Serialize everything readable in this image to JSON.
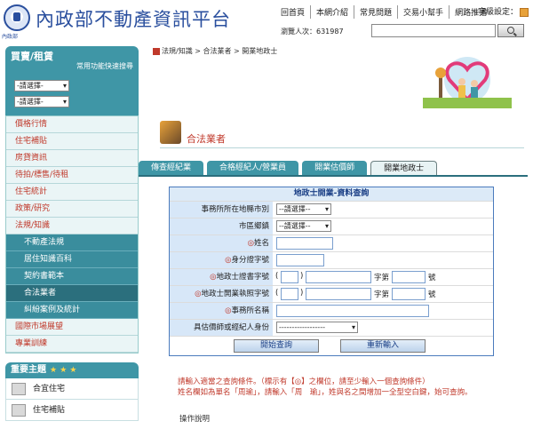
{
  "header": {
    "site_title": "內政部不動產資訊平台",
    "logo_caption": "內政部",
    "nav": [
      "回首頁",
      "本網介紹",
      "常見問題",
      "交易小幫手",
      "網路推播"
    ],
    "fontsize_label": "字級設定：",
    "visitors_label": "瀏覽人次：",
    "visitors_count": "631987",
    "search_placeholder": ""
  },
  "sidebar": {
    "buy_title": "買賣/租賃",
    "buy_subtitle": "常用功能快速搜尋",
    "select1": "-請選擇-",
    "select2": "-請選擇-",
    "menu": [
      {
        "label": "價格行情",
        "type": "main"
      },
      {
        "label": "住宅補貼",
        "type": "main"
      },
      {
        "label": "房貸資訊",
        "type": "main"
      },
      {
        "label": "待拍/標售/待租",
        "type": "main"
      },
      {
        "label": "住宅統計",
        "type": "main"
      },
      {
        "label": "政策/研究",
        "type": "main"
      },
      {
        "label": "法規/知識",
        "type": "main"
      },
      {
        "label": "不動產法規",
        "type": "sub"
      },
      {
        "label": "居住知識百科",
        "type": "sub"
      },
      {
        "label": "契約書範本",
        "type": "sub"
      },
      {
        "label": "合法業者",
        "type": "sub-active"
      },
      {
        "label": "糾紛案例及統計",
        "type": "sub"
      },
      {
        "label": "國際市場展望",
        "type": "main"
      },
      {
        "label": "專業訓練",
        "type": "main"
      }
    ],
    "important_title": "重要主題",
    "important_stars": "★ ★ ★",
    "important_items": [
      "合宜住宅",
      "住宅補貼"
    ]
  },
  "main": {
    "breadcrumb": "法規/知識 > 合法業者 > 開業地政士",
    "section_title": "合法業者",
    "tabs": [
      {
        "label": "傳查經紀業",
        "active": false
      },
      {
        "label": "合格經紀人/營業員",
        "active": false
      },
      {
        "label": "開業估價師",
        "active": false
      },
      {
        "label": "開業地政士",
        "active": true
      }
    ],
    "form": {
      "title": "地政士開業-資料查詢",
      "city_label": "事務所所在地縣市別",
      "city_value": "--請選擇--",
      "district_label": "市區鄉鎮",
      "district_value": "--請選擇--",
      "name_label": "姓名",
      "id_label": "身分證字號",
      "cert_label": "地政士證書字號",
      "license_label": "地政士開業執照字號",
      "office_label": "事務所名稱",
      "role_label": "具估價師或經紀人身份",
      "role_value": "------------------",
      "word_label": "字第",
      "number_label": "號",
      "paren_open": "(",
      "paren_close": ")",
      "required_mark": "◎",
      "submit_label": "開始查詢",
      "reset_label": "重新輸入"
    },
    "notes": [
      "請輸入適當之查詢條件。（標示有【◎】之欄位，請至少輸入一個查詢條件）",
      "姓名欄如為單名「周瑜」，請輸入「周　瑜」，姓與名之間增加一全型空白鍵，始可查詢。"
    ],
    "howto": "操作說明"
  }
}
